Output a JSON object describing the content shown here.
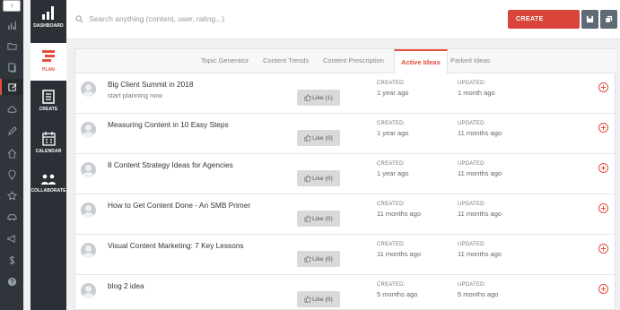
{
  "rail": {
    "select_glyph": "↑",
    "icons": [
      "bar-chart-icon",
      "folder-icon",
      "copy-icon",
      "edit-icon",
      "cloud-icon",
      "pencil-icon",
      "home-icon",
      "location-pin-icon",
      "star-icon",
      "car-icon",
      "megaphone-icon",
      "dollar-icon",
      "help-icon"
    ],
    "active_icon": "edit-icon"
  },
  "nav": {
    "items": [
      {
        "label": "DASHBOARD",
        "icon": "bar-chart-icon"
      },
      {
        "label": "PLAN",
        "icon": "plan-icon"
      },
      {
        "label": "CREATE",
        "icon": "document-icon"
      },
      {
        "label": "CALENDAR",
        "icon": "calendar-icon"
      },
      {
        "label": "COLLABORATE",
        "icon": "people-icon"
      }
    ],
    "active": "PLAN"
  },
  "header": {
    "search_placeholder": "Search anything (content, user, rating...)",
    "create_label": "CREATE"
  },
  "tabs": [
    "Topic Generator",
    "Content Trends",
    "Content Prescription",
    "Active Ideas",
    "Parked Ideas"
  ],
  "active_tab": "Active Ideas",
  "created_label": "CREATED:",
  "updated_label": "UPDATED:",
  "ideas": [
    {
      "title": "Big Client Summit in 2018",
      "subtitle": "start planning now",
      "like": "Like (1)",
      "created": "1 year ago",
      "updated": "1 month ago"
    },
    {
      "title": "Measuring Content in 10 Easy Steps",
      "subtitle": "",
      "like": "Like (0)",
      "created": "1 year ago",
      "updated": "11 months ago"
    },
    {
      "title": "8 Content Strategy Ideas for Agencies",
      "subtitle": "",
      "like": "Like (0)",
      "created": "1 year ago",
      "updated": "11 months ago"
    },
    {
      "title": "How to Get Content Done - An SMB Primer",
      "subtitle": "",
      "like": "Like (0)",
      "created": "11 months ago",
      "updated": "11 months ago"
    },
    {
      "title": "Visual Content Marketing: 7 Key Lessons",
      "subtitle": "",
      "like": "Like (0)",
      "created": "11 months ago",
      "updated": "11 months ago"
    },
    {
      "title": "blog 2 idea",
      "subtitle": "",
      "like": "Like (0)",
      "created": "5 months ago",
      "updated": "5 months ago"
    }
  ],
  "colors": {
    "accent": "#e74c3c",
    "create_button": "#d9453b",
    "sidebar": "#2a3036"
  }
}
